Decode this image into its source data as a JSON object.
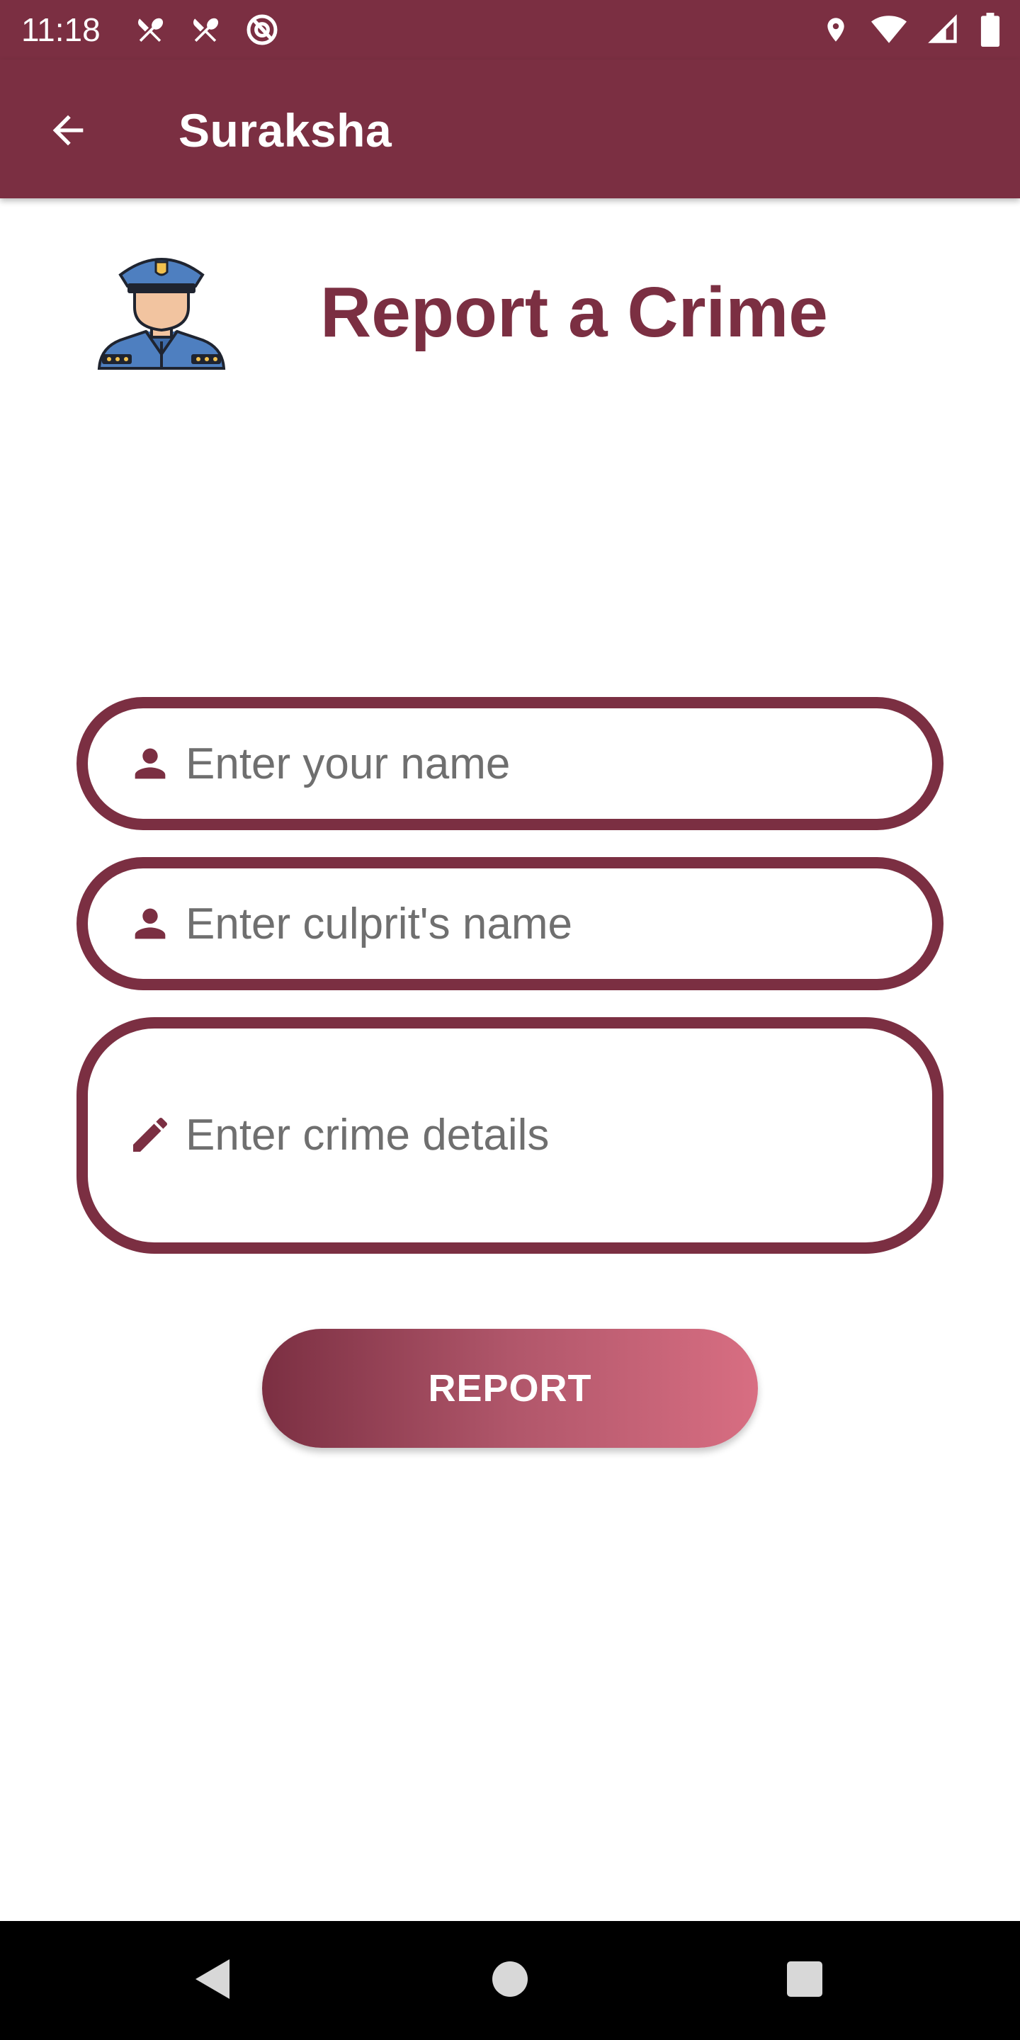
{
  "status_bar": {
    "time": "11:18",
    "left_icons": [
      "restaurant-icon",
      "restaurant-icon",
      "no-location-icon"
    ],
    "right_icons": [
      "location-pin-icon",
      "wifi-icon",
      "cell-signal-icon",
      "battery-icon"
    ]
  },
  "app_bar": {
    "title": "Suraksha",
    "back_icon": "arrow-back-icon"
  },
  "header": {
    "title": "Report a Crime",
    "avatar_icon": "police-officer-icon"
  },
  "form": {
    "name_field": {
      "placeholder": "Enter your name",
      "value": "",
      "icon": "person-icon"
    },
    "culprit_field": {
      "placeholder": "Enter culprit's name",
      "value": "",
      "icon": "person-icon"
    },
    "details_field": {
      "placeholder": "Enter crime details",
      "value": "",
      "icon": "pencil-icon"
    }
  },
  "report_button": {
    "label": "REPORT"
  },
  "nav_bar": {
    "back_icon": "nav-back-icon",
    "home_icon": "nav-home-icon",
    "recents_icon": "nav-recents-icon"
  },
  "colors": {
    "primary": "#7b2f42",
    "gradient_end": "#d86e82",
    "placeholder": "#6f6f6f",
    "background": "#ffffff"
  }
}
